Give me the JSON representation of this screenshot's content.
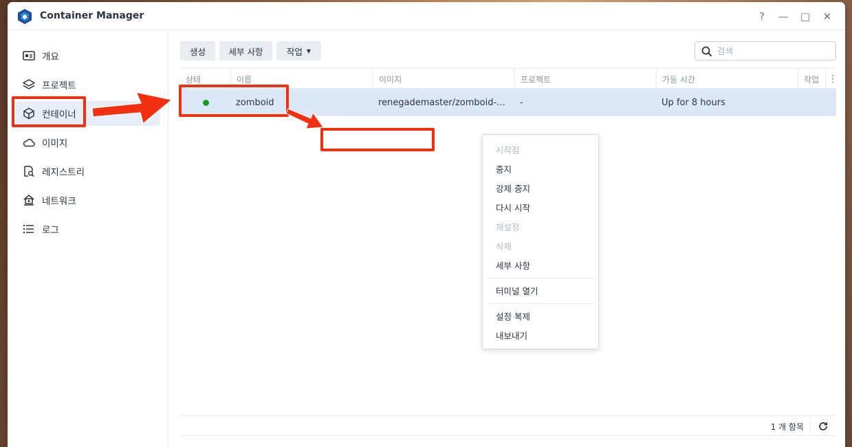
{
  "app": {
    "title": "Container Manager",
    "window_controls": [
      "?",
      "—",
      "□",
      "✕"
    ]
  },
  "sidebar": {
    "items": [
      {
        "label": "개요",
        "icon": "overview-icon"
      },
      {
        "label": "프로젝트",
        "icon": "layers-icon"
      },
      {
        "label": "컨테이너",
        "icon": "cube-icon"
      },
      {
        "label": "이미지",
        "icon": "cloud-icon"
      },
      {
        "label": "레지스트리",
        "icon": "registry-search-icon"
      },
      {
        "label": "네트워크",
        "icon": "network-icon"
      },
      {
        "label": "로그",
        "icon": "list-icon"
      }
    ],
    "active_index": 2
  },
  "toolbar": {
    "create_label": "생성",
    "details_label": "세부 사항",
    "action_label": "작업"
  },
  "search": {
    "placeholder": "검색"
  },
  "table": {
    "columns": [
      "상태",
      "이름",
      "이미지",
      "프로젝트",
      "가동 시간",
      "작업"
    ],
    "rows": [
      {
        "status": "running",
        "name": "zomboid",
        "image": "renegademaster/zomboid-...",
        "project": "-",
        "uptime": "Up for 8 hours",
        "action": ""
      }
    ]
  },
  "context_menu": {
    "items": [
      {
        "label": "시작점",
        "disabled": true
      },
      {
        "label": "중지",
        "disabled": false
      },
      {
        "label": "강제 중지",
        "disabled": false
      },
      {
        "label": "다시 시작",
        "disabled": false
      },
      {
        "label": "재설정",
        "disabled": true
      },
      {
        "label": "삭제",
        "disabled": true
      },
      {
        "label": "세부 사항",
        "disabled": false
      },
      {
        "label": "터미널 열기",
        "disabled": false
      },
      {
        "label": "설정 복제",
        "disabled": false
      },
      {
        "label": "내보내기",
        "disabled": false
      }
    ]
  },
  "footer": {
    "item_count": "1 개 항목"
  },
  "colors": {
    "accent": "#1a6fd6",
    "highlight": "#f2300f",
    "running": "#1a9a2a",
    "selected_row": "#dce8f8"
  }
}
